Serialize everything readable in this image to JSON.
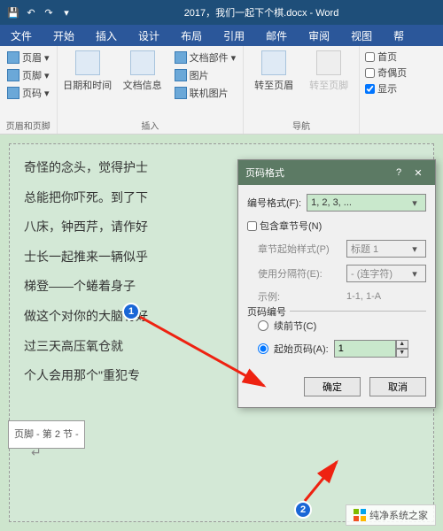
{
  "titlebar": {
    "save_icon": "💾",
    "undo_icon": "↶",
    "redo_icon": "↷",
    "dropdown": "▾",
    "title": "2017，我们一起下个棋.docx - Word"
  },
  "tabs": [
    "文件",
    "开始",
    "插入",
    "设计",
    "布局",
    "引用",
    "邮件",
    "审阅",
    "视图",
    "帮"
  ],
  "ribbon": {
    "groups": {
      "hf": {
        "label": "页眉和页脚",
        "header": "页眉 ▾",
        "footer": "页脚 ▾",
        "pagenum": "页码 ▾"
      },
      "insert": {
        "label": "插入",
        "datetime": "日期和时间",
        "docinfo": "文档信息",
        "docparts": "文档部件 ▾",
        "picture": "图片",
        "online": "联机图片"
      },
      "nav": {
        "label": "导航",
        "gohead": "转至页眉",
        "gofoot": "转至页脚"
      },
      "opts": {
        "diff": "首页",
        "oddeven": "奇偶页",
        "show": "显示"
      }
    }
  },
  "doc": {
    "lines": [
      "奇怪的念头，觉得护士",
      "总能把你吓死。到了下",
      "八床，钟西芹，请作好",
      "士长一起推来一辆似乎",
      "梯登——个蜷着身子",
      "做这个对你的大脑有好",
      "过三天高压氧仓就",
      "个人会用那个\"重犯专"
    ],
    "footer_label": "页脚 - 第 2 节 -",
    "paramark": "↵"
  },
  "dialog": {
    "title": "页码格式",
    "help": "?",
    "close": "✕",
    "fmt_label": "编号格式(F):",
    "fmt_value": "1, 2, 3, ...",
    "chapter": "包含章节号(N)",
    "chapter_style_l": "章节起始样式(P)",
    "chapter_style_v": "标题 1",
    "sep_l": "使用分隔符(E):",
    "sep_v": "- (连字符)",
    "example_l": "示例:",
    "example_v": "1-1, 1-A",
    "pagenum_legend": "页码编号",
    "continue": "续前节(C)",
    "startat": "起始页码(A):",
    "startat_v": "1",
    "ok": "确定",
    "cancel": "取消"
  },
  "badges": {
    "b1": "1",
    "b2": "2"
  },
  "watermark": "纯净系统之家"
}
